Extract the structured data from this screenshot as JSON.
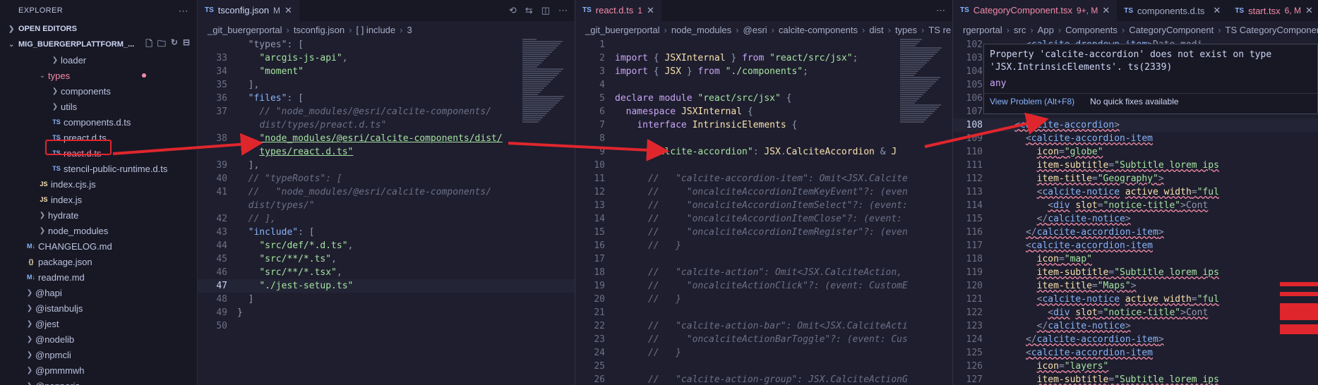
{
  "explorer": {
    "title": "EXPLORER",
    "open_editors": "OPEN EDITORS",
    "project": "MIG_BUERGERPLATTFORM_...",
    "tree": [
      {
        "label": "loader",
        "indent": 70,
        "kind": "folder",
        "open": false
      },
      {
        "label": "types",
        "indent": 52,
        "kind": "folder",
        "open": true,
        "error": true
      },
      {
        "label": "components",
        "indent": 70,
        "kind": "folder",
        "open": false
      },
      {
        "label": "utils",
        "indent": 70,
        "kind": "folder",
        "open": false
      },
      {
        "label": "components.d.ts",
        "indent": 70,
        "kind": "ts"
      },
      {
        "label": "preact.d.ts",
        "indent": 70,
        "kind": "ts"
      },
      {
        "label": "react.d.ts",
        "indent": 70,
        "kind": "ts",
        "error": true
      },
      {
        "label": "stencil-public-runtime.d.ts",
        "indent": 70,
        "kind": "ts"
      },
      {
        "label": "index.cjs.js",
        "indent": 52,
        "kind": "js"
      },
      {
        "label": "index.js",
        "indent": 52,
        "kind": "js"
      },
      {
        "label": "hydrate",
        "indent": 52,
        "kind": "folder",
        "open": false
      },
      {
        "label": "node_modules",
        "indent": 52,
        "kind": "folder",
        "open": false
      },
      {
        "label": "CHANGELOG.md",
        "indent": 34,
        "kind": "md"
      },
      {
        "label": "package.json",
        "indent": 34,
        "kind": "json"
      },
      {
        "label": "readme.md",
        "indent": 34,
        "kind": "md"
      },
      {
        "label": "@hapi",
        "indent": 34,
        "kind": "folder",
        "open": false
      },
      {
        "label": "@istanbuljs",
        "indent": 34,
        "kind": "folder",
        "open": false
      },
      {
        "label": "@jest",
        "indent": 34,
        "kind": "folder",
        "open": false
      },
      {
        "label": "@nodelib",
        "indent": 34,
        "kind": "folder",
        "open": false
      },
      {
        "label": "@npmcli",
        "indent": 34,
        "kind": "folder",
        "open": false
      },
      {
        "label": "@pmmmwh",
        "indent": 34,
        "kind": "folder",
        "open": false
      },
      {
        "label": "@popperjs",
        "indent": 34,
        "kind": "folder",
        "open": false
      }
    ]
  },
  "pane1": {
    "tab": {
      "lang": "TS",
      "name": "tsconfig.json",
      "badge": "M"
    },
    "crumbs": [
      "_git_buergerportal",
      "tsconfig.json",
      "[ ] include",
      "3"
    ],
    "lines": [
      {
        "n": "",
        "html": "<span class='p'>  \"types\": [</span>"
      },
      {
        "n": "33",
        "html": "    <span class='s'>\"arcgis-js-api\"</span><span class='p'>,</span>"
      },
      {
        "n": "34",
        "html": "    <span class='s'>\"moment\"</span>"
      },
      {
        "n": "35",
        "html": "  <span class='p'>],</span>"
      },
      {
        "n": "36",
        "html": "  <span class='pr'>\"files\"</span><span class='p'>: [</span>"
      },
      {
        "n": "37",
        "html": "    <span class='c'>// \"node_modules/@esri/calcite-components/</span>"
      },
      {
        "n": "",
        "html": "    <span class='c'>dist/types/preact.d.ts\"</span>"
      },
      {
        "n": "38",
        "html": "    <span class='s' style='text-decoration:underline'>\"node_modules/@esri/calcite-components/dist/</span>"
      },
      {
        "n": "",
        "html": "    <span class='s' style='text-decoration:underline'>types/react.d.ts\"</span>"
      },
      {
        "n": "39",
        "html": "  <span class='p'>],</span>"
      },
      {
        "n": "40",
        "html": "  <span class='c'>// \"typeRoots\": [</span>"
      },
      {
        "n": "41",
        "html": "  <span class='c'>//   \"node_modules/@esri/calcite-components/</span>"
      },
      {
        "n": "",
        "html": "  <span class='c'>dist/types/\"</span>"
      },
      {
        "n": "42",
        "html": "  <span class='c'>// ],</span>"
      },
      {
        "n": "43",
        "html": "  <span class='pr'>\"include\"</span><span class='p'>: [</span>"
      },
      {
        "n": "44",
        "html": "    <span class='s'>\"src/def/*.d.ts\"</span><span class='p'>,</span>"
      },
      {
        "n": "45",
        "html": "    <span class='s'>\"src/**/*.ts\"</span><span class='p'>,</span>"
      },
      {
        "n": "46",
        "html": "    <span class='s'>\"src/**/*.tsx\"</span><span class='p'>,</span>"
      },
      {
        "n": "47",
        "html": "    <span class='s'>\"./jest-setup.ts\"</span>",
        "cur": true
      },
      {
        "n": "48",
        "html": "  <span class='p'>]</span>"
      },
      {
        "n": "49",
        "html": "<span class='p'>}</span>"
      },
      {
        "n": "50",
        "html": ""
      }
    ]
  },
  "pane2": {
    "tab": {
      "lang": "TS",
      "name": "react.d.ts",
      "badge": "1"
    },
    "crumbs": [
      "_git_buergerportal",
      "node_modules",
      "@esri",
      "calcite-components",
      "dist",
      "types",
      "TS re"
    ],
    "lines": [
      {
        "n": "1",
        "html": ""
      },
      {
        "n": "2",
        "html": "<span class='k'>import</span> <span class='p'>{</span> <span class='ty'>JSXInternal</span> <span class='p'>}</span> <span class='k'>from</span> <span class='s'>\"react/src/jsx\"</span><span class='p'>;</span>"
      },
      {
        "n": "3",
        "html": "<span class='k'>import</span> <span class='p'>{</span> <span class='ty'>JSX</span> <span class='p'>}</span> <span class='k'>from</span> <span class='s'>\"./components\"</span><span class='p'>;</span>"
      },
      {
        "n": "4",
        "html": ""
      },
      {
        "n": "5",
        "html": "<span class='k'>declare module</span> <span class='s'>\"react/src/jsx\"</span> <span class='p'>{</span>"
      },
      {
        "n": "6",
        "html": "  <span class='k'>namespace</span> <span class='ty'>JSXInternal</span> <span class='p'>{</span>"
      },
      {
        "n": "7",
        "html": "    <span class='k'>interface</span> <span class='ty'>IntrinsicElements</span> <span class='p'>{</span>"
      },
      {
        "n": "8",
        "html": ""
      },
      {
        "n": "9",
        "html": "      <span class='s'>\"calcite-accordion\"</span><span class='p'>:</span> <span class='ty'>JSX</span><span class='p'>.</span><span class='ty'>CalciteAccordion</span> <span class='p'>&amp;</span> <span class='ty'>J</span>"
      },
      {
        "n": "10",
        "html": ""
      },
      {
        "n": "11",
        "html": "      <span class='c'>//   \"calcite-accordion-item\": Omit&lt;JSX.Calcite</span>"
      },
      {
        "n": "12",
        "html": "      <span class='c'>//     \"oncalciteAccordionItemKeyEvent\"?: (even</span>"
      },
      {
        "n": "13",
        "html": "      <span class='c'>//     \"oncalciteAccordionItemSelect\"?: (event:</span>"
      },
      {
        "n": "14",
        "html": "      <span class='c'>//     \"oncalciteAccordionItemClose\"?: (event: </span>"
      },
      {
        "n": "15",
        "html": "      <span class='c'>//     \"oncalciteAccordionItemRegister\"?: (even</span>"
      },
      {
        "n": "16",
        "html": "      <span class='c'>//   }</span>"
      },
      {
        "n": "17",
        "html": ""
      },
      {
        "n": "18",
        "html": "      <span class='c'>//   \"calcite-action\": Omit&lt;JSX.CalciteAction, </span>"
      },
      {
        "n": "19",
        "html": "      <span class='c'>//     \"oncalciteActionClick\"?: (event: CustomE</span>"
      },
      {
        "n": "20",
        "html": "      <span class='c'>//   }</span>"
      },
      {
        "n": "21",
        "html": ""
      },
      {
        "n": "22",
        "html": "      <span class='c'>//   \"calcite-action-bar\": Omit&lt;JSX.CalciteActi</span>"
      },
      {
        "n": "23",
        "html": "      <span class='c'>//     \"oncalciteActionBarToggle\"?: (event: Cus</span>"
      },
      {
        "n": "24",
        "html": "      <span class='c'>//   }</span>"
      },
      {
        "n": "25",
        "html": ""
      },
      {
        "n": "26",
        "html": "      <span class='c'>//   \"calcite-action-group\": JSX.CalciteActionG</span>"
      }
    ]
  },
  "pane3": {
    "tabs": [
      {
        "lang": "TS",
        "name": "CategoryComponent.tsx",
        "badge": "9+, M",
        "active": true
      },
      {
        "lang": "TS",
        "name": "components.d.ts",
        "badge": ""
      },
      {
        "lang": "TS",
        "name": "start.tsx",
        "badge": "6, M"
      }
    ],
    "crumbs": [
      "rgerportal",
      "src",
      "App",
      "Components",
      "CategoryComponent",
      "TS CategoryComponent.tsx"
    ],
    "lines": [
      {
        "n": "102",
        "html": "      <span class='p'>&lt;</span><span class='tg'>calcite-dropdown-item</span><span class='p'>&gt;Date modi</span>"
      },
      {
        "n": "103",
        "html": ""
      },
      {
        "n": "104",
        "html": ""
      },
      {
        "n": "105",
        "html": ""
      },
      {
        "n": "106",
        "html": ""
      },
      {
        "n": "107",
        "html": ""
      },
      {
        "n": "108",
        "html": "    <span class='p squig'>&lt;</span><span class='tg squig'>calcite-accordion</span><span class='p squig'>&gt;</span>",
        "cur": true
      },
      {
        "n": "109",
        "html": "      <span class='p squig'>&lt;</span><span class='tg squig'>calcite-accordion-item</span>"
      },
      {
        "n": "110",
        "html": "        <span class='at squig'>icon</span><span class='p squig'>=</span><span class='s squig'>\"globe\"</span>"
      },
      {
        "n": "111",
        "html": "        <span class='at squig'>item-subtitle</span><span class='p squig'>=</span><span class='s squig'>\"Subtitle lorem ips</span>"
      },
      {
        "n": "112",
        "html": "        <span class='at squig'>item-title</span><span class='p squig'>=</span><span class='s squig'>\"Geography\"</span><span class='p squig'>&gt;</span>"
      },
      {
        "n": "113",
        "html": "        <span class='p squig'>&lt;</span><span class='tg squig'>calcite-notice</span> <span class='at squig'>active width</span><span class='p squig'>=</span><span class='s squig'>\"ful</span>"
      },
      {
        "n": "114",
        "html": "          <span class='p squig'>&lt;</span><span class='tg squig'>div</span> <span class='at squig'>slot</span><span class='p squig'>=</span><span class='s squig'>\"notice-title\"</span><span class='p squig'>&gt;Cont</span>"
      },
      {
        "n": "115",
        "html": "        <span class='p squig'>&lt;/</span><span class='tg squig'>calcite-notice</span><span class='p squig'>&gt;</span>"
      },
      {
        "n": "116",
        "html": "      <span class='p squig'>&lt;/</span><span class='tg squig'>calcite-accordion-item</span><span class='p squig'>&gt;</span>"
      },
      {
        "n": "117",
        "html": "      <span class='p squig'>&lt;</span><span class='tg squig'>calcite-accordion-item</span>"
      },
      {
        "n": "118",
        "html": "        <span class='at squig'>icon</span><span class='p squig'>=</span><span class='s squig'>\"map\"</span>"
      },
      {
        "n": "119",
        "html": "        <span class='at squig'>item-subtitle</span><span class='p squig'>=</span><span class='s squig'>\"Subtitle lorem ips</span>"
      },
      {
        "n": "120",
        "html": "        <span class='at squig'>item-title</span><span class='p squig'>=</span><span class='s squig'>\"Maps\"</span><span class='p squig'>&gt;</span>"
      },
      {
        "n": "121",
        "html": "        <span class='p squig'>&lt;</span><span class='tg squig'>calcite-notice</span> <span class='at squig'>active width</span><span class='p squig'>=</span><span class='s squig'>\"ful</span>"
      },
      {
        "n": "122",
        "html": "          <span class='p squig'>&lt;</span><span class='tg squig'>div</span> <span class='at squig'>slot</span><span class='p squig'>=</span><span class='s squig'>\"notice-title\"</span><span class='p squig'>&gt;Cont</span>"
      },
      {
        "n": "123",
        "html": "        <span class='p squig'>&lt;/</span><span class='tg squig'>calcite-notice</span><span class='p squig'>&gt;</span>"
      },
      {
        "n": "124",
        "html": "      <span class='p squig'>&lt;/</span><span class='tg squig'>calcite-accordion-item</span><span class='p squig'>&gt;</span>"
      },
      {
        "n": "125",
        "html": "      <span class='p squig'>&lt;</span><span class='tg squig'>calcite-accordion-item</span>"
      },
      {
        "n": "126",
        "html": "        <span class='at squig'>icon</span><span class='p squig'>=</span><span class='s squig'>\"layers\"</span>"
      },
      {
        "n": "127",
        "html": "        <span class='at squig'>item-subtitle</span><span class='p squig'>=</span><span class='s squig'>\"Subtitle lorem ips</span>"
      }
    ]
  },
  "hover": {
    "message_line1": "Property 'calcite-accordion' does not exist on type",
    "message_line2": "'JSX.IntrinsicElements'. ts(2339)",
    "type": "any",
    "view_problem": "View Problem (Alt+F8)",
    "no_fix": "No quick fixes available"
  },
  "colors": {
    "arrow": "#e0262d",
    "error": "#f38ba8"
  }
}
